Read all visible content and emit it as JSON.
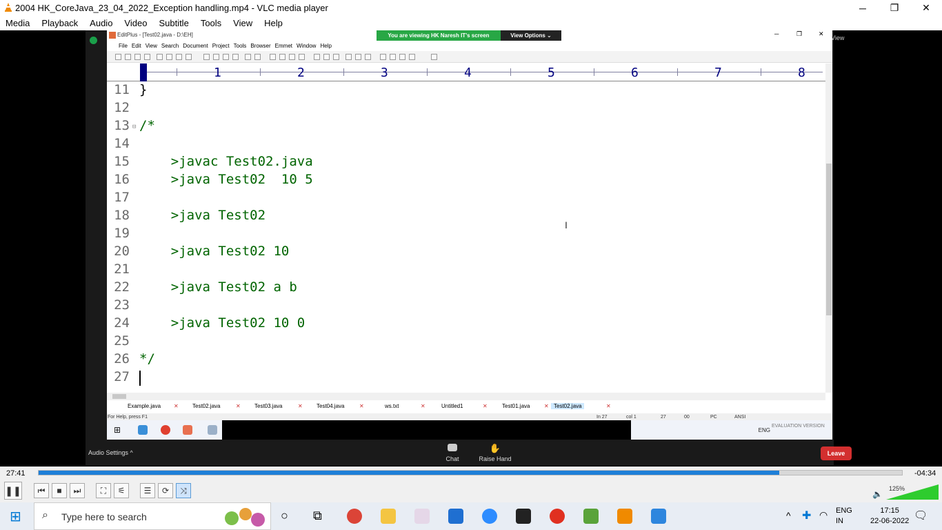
{
  "vlc": {
    "title": "2004 HK_CoreJava_23_04_2022_Exception handling.mp4 - VLC media player",
    "window_controls": {
      "minimize": "─",
      "maximize": "❐",
      "close": "✕"
    },
    "menu": [
      "Media",
      "Playback",
      "Audio",
      "Video",
      "Subtitle",
      "Tools",
      "View",
      "Help"
    ],
    "elapsed": "27:41",
    "remaining": "-04:34",
    "progress": 0.858,
    "volume": "125%",
    "colors": {
      "accent": "#1e7fd8",
      "volume_green": "#2ecc2e"
    }
  },
  "zoom": {
    "banner_text": "You are viewing HK Naresh IT's screen",
    "view_options": "View Options ⌄",
    "view_label": "View",
    "audio_settings": "Audio Settings  ^",
    "chat": "Chat",
    "raise_hand": "Raise Hand",
    "leave": "Leave",
    "colors": {
      "banner_green": "#28a745",
      "leave_red": "#d32f2f"
    }
  },
  "editplus": {
    "title": "EditPlus - [Test02.java - D:\\EH]",
    "menu": [
      "File",
      "Edit",
      "View",
      "Search",
      "Document",
      "Project",
      "Tools",
      "Browser",
      "Emmet",
      "Window",
      "Help"
    ],
    "ruler_numbers": [
      "1",
      "2",
      "3",
      "4",
      "5",
      "6",
      "7",
      "8"
    ],
    "code_lines": [
      {
        "num": "11",
        "text": "}"
      },
      {
        "num": "12",
        "text": ""
      },
      {
        "num": "13",
        "text": "/*"
      },
      {
        "num": "14",
        "text": ""
      },
      {
        "num": "15",
        "text": "    >javac Test02.java"
      },
      {
        "num": "16",
        "text": "    >java Test02  10 5"
      },
      {
        "num": "17",
        "text": ""
      },
      {
        "num": "18",
        "text": "    >java Test02"
      },
      {
        "num": "19",
        "text": ""
      },
      {
        "num": "20",
        "text": "    >java Test02 10"
      },
      {
        "num": "21",
        "text": ""
      },
      {
        "num": "22",
        "text": "    >java Test02 a b"
      },
      {
        "num": "23",
        "text": ""
      },
      {
        "num": "24",
        "text": "    >java Test02 10 0"
      },
      {
        "num": "25",
        "text": ""
      },
      {
        "num": "26",
        "text": "*/"
      },
      {
        "num": "27",
        "text": ""
      }
    ],
    "tabs": [
      "Example.java",
      "Test02.java",
      "Test03.java",
      "Test04.java",
      "ws.txt",
      "Untitled1",
      "Test01.java",
      "Test02.java"
    ],
    "status": {
      "help": "For Help, press F1",
      "line": "In 27",
      "col": "col 1",
      "n1": "27",
      "n2": "00",
      "pc": "PC",
      "enc": "ANSI"
    },
    "colors": {
      "code_green": "#006400",
      "ruler_blue": "#000080"
    }
  },
  "remote_taskbar": {
    "tray_lang": "ENG",
    "evaluation": "EVALUATION VERSION"
  },
  "taskbar": {
    "search_placeholder": "Type here to search",
    "lang": "ENG",
    "region": "IN",
    "time": "17:15",
    "date": "22-06-2022"
  }
}
